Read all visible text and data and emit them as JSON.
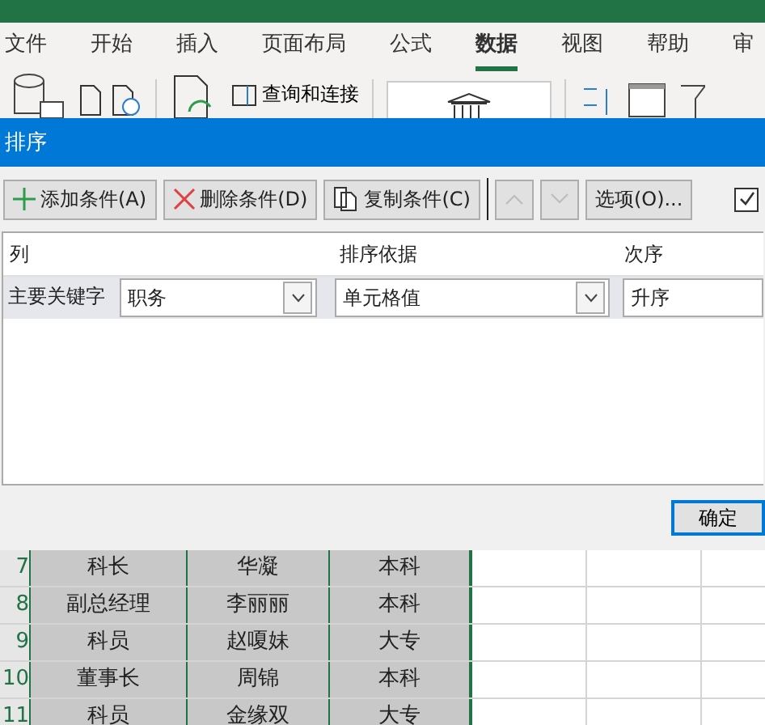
{
  "ribbon_tabs": [
    {
      "label": "文件",
      "selected": false
    },
    {
      "label": "开始",
      "selected": false
    },
    {
      "label": "插入",
      "selected": false
    },
    {
      "label": "页面布局",
      "selected": false
    },
    {
      "label": "公式",
      "selected": false
    },
    {
      "label": "数据",
      "selected": true
    },
    {
      "label": "视图",
      "selected": false
    },
    {
      "label": "帮助",
      "selected": false
    },
    {
      "label": "审",
      "selected": false
    }
  ],
  "ribbon": {
    "query_button": "查询和连接"
  },
  "dialog": {
    "title": "排序",
    "toolbar": [
      {
        "kind": "add",
        "label": "添加条件(A)",
        "disabled": false
      },
      {
        "kind": "delete",
        "label": "删除条件(D)",
        "disabled": false
      },
      {
        "kind": "copy",
        "label": "复制条件(C)",
        "disabled": false
      },
      {
        "kind": "up",
        "disabled": true
      },
      {
        "kind": "down",
        "disabled": true
      },
      {
        "kind": "text",
        "label": "选项(O)...",
        "disabled": false
      }
    ],
    "header_checkbox": {
      "checked": true
    },
    "columns": [
      "列",
      "排序依据",
      "次序"
    ],
    "rows": [
      {
        "label": "主要关键字",
        "column": "职务",
        "sort_on": "单元格值",
        "order": "升序"
      }
    ],
    "ok_button": "确定"
  },
  "sheet": {
    "rows": [
      {
        "number": "7",
        "cells": [
          "科长",
          "华凝",
          "本科"
        ]
      },
      {
        "number": "8",
        "cells": [
          "副总经理",
          "李丽丽",
          "本科"
        ]
      },
      {
        "number": "9",
        "cells": [
          "科员",
          "赵嗄妹",
          "大专"
        ]
      },
      {
        "number": "10",
        "cells": [
          "董事长",
          "周锦",
          "本科"
        ]
      },
      {
        "number": "11",
        "cells": [
          "科员",
          "金缘双",
          "大专"
        ]
      }
    ]
  }
}
